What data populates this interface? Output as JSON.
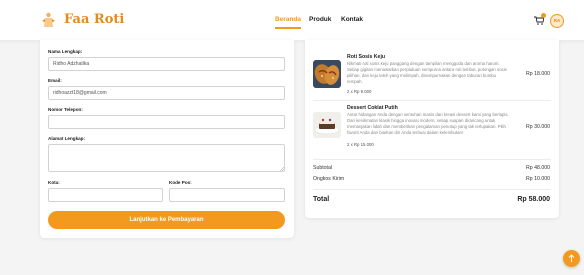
{
  "brand": {
    "name": "Faa Roti"
  },
  "nav": {
    "items": [
      "Beranda",
      "Produk",
      "Kontak"
    ],
    "active": "Beranda"
  },
  "user": {
    "avatar_initials": "RA"
  },
  "form": {
    "name_label": "Nama Lengkap:",
    "name_value": "Ridho Adzhatika",
    "email_label": "Email:",
    "email_value": "ridhoazzt18@gmail.com",
    "phone_label": "Nomor Telepon:",
    "phone_value": "",
    "address_label": "Alamat Lengkap:",
    "address_value": "",
    "city_label": "Kota:",
    "city_value": "",
    "postal_label": "Kode Pos:",
    "postal_value": "",
    "submit_label": "Lanjutkan ke Pembayaran"
  },
  "order": {
    "items": [
      {
        "name": "Roti Sosis Keju",
        "description": "Nikmati roti sosis keju panggang dengan tampilan menggoda dan aroma harum. Setiap gigitan menawarkan perpaduan sempurna antara roti lembut, potongan sosis pilihan, dan keju leleh yang melimpah, disempurnakan dengan taburan bumbu rempah.",
        "qty": "2 x Rp 9.000",
        "price": "Rp 18.000"
      },
      {
        "name": "Dessert Coklat Putih",
        "description": "Antar hidangan Anda dengan sentuhan manis dari kreasi dessert kami yang berlapis. Dari kenikmatan klasik hingga inovasi modern, setiap suapan dirancang untuk memanjakan lidah dan memberikan pengalaman penutup yang tak terlupakan. Pilih favorit Anda dan biarkan diri Anda terbuai dalam kelembutan!",
        "qty": "2 x Rp 15.000",
        "price": "Rp 30.000"
      }
    ],
    "subtotal_label": "Subtotal",
    "subtotal_value": "Rp 48.000",
    "shipping_label": "Ongkos Kirim",
    "shipping_value": "Rp 10.000",
    "total_label": "Total",
    "total_value": "Rp 58.000"
  },
  "colors": {
    "accent": "#f39a1e",
    "brand": "#e58b1a",
    "background": "#f4f4f5"
  },
  "icons": {
    "logo": "chef-logo-icon",
    "cart": "cart-icon",
    "scroll_top": "arrow-up-icon"
  }
}
